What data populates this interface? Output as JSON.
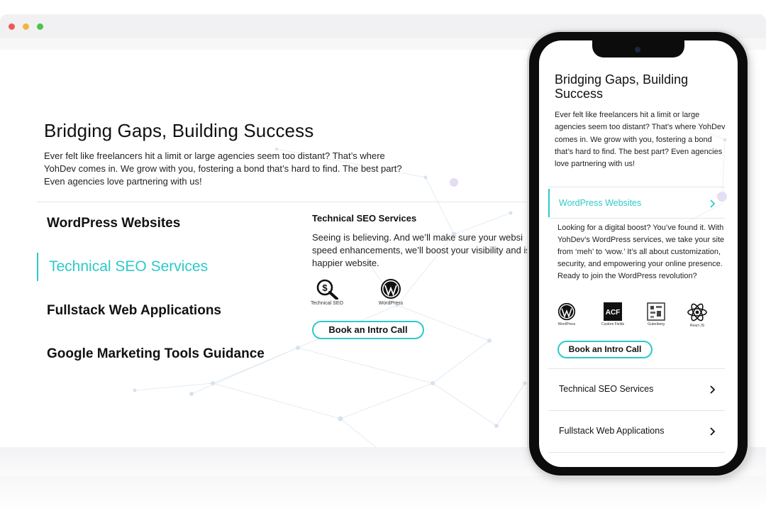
{
  "desktop": {
    "title": "Bridging Gaps, Building Success",
    "intro": "Ever felt like freelancers hit a limit or large agencies seem too distant? That’s where YohDev comes in. We grow with you, fostering a bond that’s hard to find. The best part? Even agencies love partnering with us!",
    "nav": [
      {
        "label": "WordPress Websites",
        "active": false
      },
      {
        "label": "Technical SEO Services",
        "active": true
      },
      {
        "label": "Fullstack Web Applications",
        "active": false
      },
      {
        "label": "Google Marketing Tools Guidance",
        "active": false
      }
    ],
    "service": {
      "title": "Technical SEO Services",
      "description": "Seeing is believing. And we’ll make sure your websi speed enhancements, we’ll boost your visibility and is a happier website.",
      "icons": [
        {
          "icon": "seo-magnifier-icon",
          "label": "Technical SEO"
        },
        {
          "icon": "wordpress-icon",
          "label": "WordPress"
        }
      ],
      "cta": "Book an Intro Call"
    }
  },
  "mobile": {
    "title": "Bridging Gaps, Building Success",
    "intro": "Ever felt like freelancers hit a limit or large agencies seem too distant? That’s where YohDev comes in. We grow with you, fostering a bond that’s hard to find. The best part? Even agencies love partnering with us!",
    "accordion": [
      {
        "label": "WordPress Websites",
        "expanded": true
      },
      {
        "label": "Technical SEO Services",
        "expanded": false
      },
      {
        "label": "Fullstack Web Applications",
        "expanded": false
      }
    ],
    "expanded_description": "Looking for a digital boost? You’ve found it. With YohDev’s WordPress services, we take your site from ‘meh’ to ‘wow.’ It’s all about customization, security, and empowering your online presence. Ready to join the WordPress revolution?",
    "icons": [
      {
        "icon": "wordpress-icon",
        "label": "WordPress"
      },
      {
        "icon": "acf-icon",
        "label": "Custom Fields",
        "mark": "ACF"
      },
      {
        "icon": "gutenberg-icon",
        "label": "Gutenberg"
      },
      {
        "icon": "react-icon",
        "label": "React JS"
      }
    ],
    "cta": "Book an Intro Call"
  },
  "colors": {
    "accent": "#2ec9c9",
    "text": "#111111",
    "window_red": "#ee5b55",
    "window_yellow": "#f2b63c",
    "window_green": "#4fc248"
  }
}
